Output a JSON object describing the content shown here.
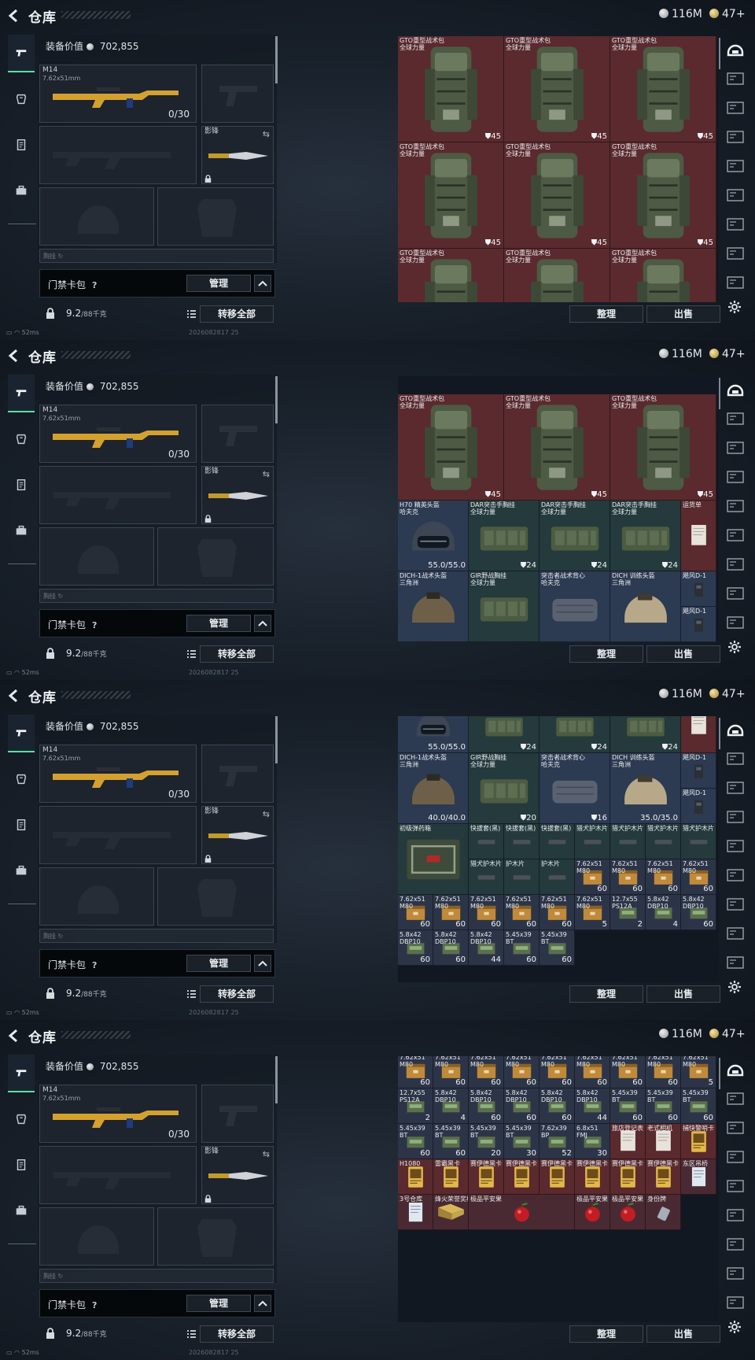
{
  "header": {
    "title": "仓库",
    "currency_silver": "116M",
    "currency_gold": "47+"
  },
  "loadout": {
    "value_label": "装备价值",
    "value": "702,855",
    "primary_weapon": {
      "name": "M14",
      "caliber": "7.62x51mm",
      "ammo": "0/30"
    },
    "melee": {
      "name": "影锋"
    },
    "strip_label": "胸挂 ↻"
  },
  "bag": {
    "name": "门禁卡包",
    "help": "?",
    "manage_label": "管理",
    "weight": "9.2",
    "weight_max": "/88千克",
    "transfer_all_label": "转移全部"
  },
  "storage": {
    "sort_label": "整理",
    "sell_label": "出售"
  },
  "status": {
    "ping": "52ms",
    "date": "2026082817 25"
  },
  "colors": {
    "accent_green": "#5be0a0",
    "tile_red": "#5a2a2e",
    "tile_blue": "#2c3a52",
    "tile_teal": "#243a3c"
  },
  "frames": [
    {
      "items": [
        {
          "n": "GTO重型战术包\n全球力量",
          "q": "⛊45",
          "t": "backpack"
        },
        {
          "n": "GTO重型战术包\n全球力量",
          "q": "⛊45",
          "t": "backpack"
        },
        {
          "n": "GTO重型战术包\n全球力量",
          "q": "⛊45",
          "t": "backpack"
        },
        {
          "n": "GTO重型战术包\n全球力量",
          "q": "⛊45",
          "t": "backpack"
        },
        {
          "n": "GTO重型战术包\n全球力量",
          "q": "⛊45",
          "t": "backpack"
        },
        {
          "n": "GTO重型战术包\n全球力量",
          "q": "⛊45",
          "t": "backpack"
        },
        {
          "n": "GTO重型战术包\n全球力量",
          "q": "",
          "t": "backpack"
        },
        {
          "n": "GTO重型战术包\n全球力量",
          "q": "",
          "t": "backpack"
        },
        {
          "n": "GTO重型战术包\n全球力量",
          "q": "",
          "t": "backpack"
        }
      ]
    },
    {
      "items": [
        {
          "n": "",
          "q": "⛊45",
          "t": "backpack"
        },
        {
          "n": "",
          "q": "⛊45",
          "t": "backpack"
        },
        {
          "n": "",
          "q": "⛊45",
          "t": "backpack"
        },
        {
          "n": "GTO重型战术包\n全球力量",
          "q": "⛊45",
          "t": "backpack"
        },
        {
          "n": "GTO重型战术包\n全球力量",
          "q": "⛊45",
          "t": "backpack"
        },
        {
          "n": "GTO重型战术包\n全球力量",
          "q": "⛊45",
          "t": "backpack"
        },
        {
          "n": "H70 精英头盔\n哈夫克",
          "q": "55.0/55.0",
          "t": "helmet"
        },
        {
          "n": "DAR突击手胸挂\n全球力量",
          "q": "⛊24",
          "t": "rig"
        },
        {
          "n": "DAR突击手胸挂\n全球力量",
          "q": "⛊24",
          "t": "rig"
        },
        {
          "n": "DAR突击手胸挂\n全球力量",
          "q": "⛊24",
          "t": "rig"
        },
        {
          "n": "运货单",
          "q": "",
          "t": "paper"
        },
        {
          "n": "DICH-1战术头盔\n三角洲",
          "q": "",
          "t": "helmet2"
        },
        {
          "n": "GIR野战胸挂\n全球力量",
          "q": "",
          "t": "rig"
        },
        {
          "n": "突击者战术背心\n哈夫克",
          "q": "",
          "t": "vest"
        },
        {
          "n": "DICH 训练头盔\n三角洲",
          "q": "",
          "t": "helmet3"
        },
        {
          "n": "飓风D-1",
          "q": "",
          "t": "device"
        },
        {
          "n": "飓风D-1",
          "q": "",
          "t": "device"
        }
      ]
    },
    {
      "items": [
        {
          "n": "",
          "q": "55.0/55.0",
          "t": "helmet"
        },
        {
          "n": "",
          "q": "⛊24",
          "t": "rig"
        },
        {
          "n": "",
          "q": "⛊24",
          "t": "rig"
        },
        {
          "n": "",
          "q": "⛊24",
          "t": "rig"
        },
        {
          "n": "",
          "q": "",
          "t": "paper"
        },
        {
          "n": "DICH-1战术头盔\n三角洲",
          "q": "40.0/40.0",
          "t": "helmet2"
        },
        {
          "n": "GIR野战胸挂\n全球力量",
          "q": "⛊20",
          "t": "rig"
        },
        {
          "n": "突击者战术背心\n哈夫克",
          "q": "⛊16",
          "t": "vest"
        },
        {
          "n": "DICH 训练头盔\n三角洲",
          "q": "35.0/35.0",
          "t": "helmet3"
        },
        {
          "n": "飓风D-1",
          "q": "",
          "t": "device"
        },
        {
          "n": "飓风D-1",
          "q": "",
          "t": "device"
        },
        {
          "n": "初级弹药箱",
          "q": "",
          "t": "ammobox"
        },
        {
          "n": "快拔套(黑)",
          "q": "",
          "t": "small"
        },
        {
          "n": "快拔套(黑)",
          "q": "",
          "t": "small"
        },
        {
          "n": "快拔套(黑)",
          "q": "",
          "t": "small"
        },
        {
          "n": "猎犬护木片",
          "q": "",
          "t": "small"
        },
        {
          "n": "猎犬护木片",
          "q": "",
          "t": "small"
        },
        {
          "n": "猎犬护木片",
          "q": "",
          "t": "small"
        },
        {
          "n": "猎犬护木片",
          "q": "",
          "t": "small"
        },
        {
          "n": "猎犬护木片",
          "q": "",
          "t": "small"
        },
        {
          "n": "护木片",
          "q": "",
          "t": "small"
        },
        {
          "n": "护木片",
          "q": "",
          "t": "small"
        },
        {
          "n": "7.62x51\nM80",
          "q": "60",
          "t": "ammo"
        },
        {
          "n": "7.62x51\nM80",
          "q": "60",
          "t": "ammo"
        },
        {
          "n": "7.62x51\nM80",
          "q": "60",
          "t": "ammo"
        },
        {
          "n": "7.62x51\nM80",
          "q": "60",
          "t": "ammo"
        },
        {
          "n": "7.62x51\nM80",
          "q": "60",
          "t": "ammo"
        },
        {
          "n": "7.62x51\nM80",
          "q": "60",
          "t": "ammo"
        },
        {
          "n": "7.62x51\nM80",
          "q": "60",
          "t": "ammo"
        },
        {
          "n": "7.62x51\nM80",
          "q": "60",
          "t": "ammo"
        },
        {
          "n": "7.62x51\nM80",
          "q": "60",
          "t": "ammo"
        },
        {
          "n": "7.62x51\nM80",
          "q": "5",
          "t": "ammo"
        },
        {
          "n": "12.7x55\nPS12A",
          "q": "2",
          "t": "ammo2"
        },
        {
          "n": "5.8x42\nDBP10",
          "q": "4",
          "t": "ammo2"
        },
        {
          "n": "5.8x42\nDBP10",
          "q": "60",
          "t": "ammo2"
        },
        {
          "n": "5.8x42\nDBP10",
          "q": "60",
          "t": "ammo2"
        },
        {
          "n": "5.8x42\nDBP10",
          "q": "60",
          "t": "ammo2"
        },
        {
          "n": "5.8x42\nDBP10",
          "q": "44",
          "t": "ammo2"
        },
        {
          "n": "5.45x39\nBT",
          "q": "60",
          "t": "ammo2"
        },
        {
          "n": "5.45x39\nBT",
          "q": "60",
          "t": "ammo2"
        }
      ]
    },
    {
      "items": [
        {
          "n": "7.62x51\nM80",
          "q": "60",
          "t": "ammo"
        },
        {
          "n": "7.62x51\nM80",
          "q": "60",
          "t": "ammo"
        },
        {
          "n": "7.62x51\nM80",
          "q": "60",
          "t": "ammo"
        },
        {
          "n": "7.62x51\nM80",
          "q": "60",
          "t": "ammo"
        },
        {
          "n": "7.62x51\nM80",
          "q": "60",
          "t": "ammo"
        },
        {
          "n": "7.62x51\nM80",
          "q": "60",
          "t": "ammo"
        },
        {
          "n": "7.62x51\nM80",
          "q": "60",
          "t": "ammo"
        },
        {
          "n": "7.62x51\nM80",
          "q": "60",
          "t": "ammo"
        },
        {
          "n": "7.62x51\nM80",
          "q": "5",
          "t": "ammo"
        },
        {
          "n": "12.7x55\nPS12A",
          "q": "2",
          "t": "ammo2"
        },
        {
          "n": "5.8x42\nDBP10",
          "q": "4",
          "t": "ammo2"
        },
        {
          "n": "5.8x42\nDBP10",
          "q": "60",
          "t": "ammo2"
        },
        {
          "n": "5.8x42\nDBP10",
          "q": "60",
          "t": "ammo2"
        },
        {
          "n": "5.8x42\nDBP10",
          "q": "60",
          "t": "ammo2"
        },
        {
          "n": "5.8x42\nDBP10",
          "q": "44",
          "t": "ammo2"
        },
        {
          "n": "5.45x39\nBT",
          "q": "60",
          "t": "ammo2"
        },
        {
          "n": "5.45x39\nBT",
          "q": "60",
          "t": "ammo2"
        },
        {
          "n": "5.45x39\nBT",
          "q": "60",
          "t": "ammo2"
        },
        {
          "n": "5.45x39\nBT",
          "q": "60",
          "t": "ammo2"
        },
        {
          "n": "5.45x39\nBT",
          "q": "60",
          "t": "ammo2"
        },
        {
          "n": "5.45x39\nBT",
          "q": "20",
          "t": "ammo2"
        },
        {
          "n": "5.45x39\nBT",
          "q": "30",
          "t": "ammo2"
        },
        {
          "n": "7.62x39\nBP",
          "q": "52",
          "t": "ammo2"
        },
        {
          "n": "6.8x51\nFMJ",
          "q": "30",
          "t": "ammo2"
        },
        {
          "n": "旅店登记表",
          "q": "",
          "t": "paper"
        },
        {
          "n": "老式相机",
          "q": "",
          "t": "paper"
        },
        {
          "n": "捕快警哨卡",
          "q": "",
          "t": "card"
        },
        {
          "n": "H1080",
          "q": "",
          "t": "card"
        },
        {
          "n": "雷霸黑卡",
          "q": "",
          "t": "card"
        },
        {
          "n": "赛伊德黑卡",
          "q": "",
          "t": "card"
        },
        {
          "n": "赛伊德黑卡",
          "q": "",
          "t": "card"
        },
        {
          "n": "赛伊德黑卡",
          "q": "",
          "t": "card"
        },
        {
          "n": "赛伊德黑卡",
          "q": "",
          "t": "card"
        },
        {
          "n": "赛伊德黑卡",
          "q": "",
          "t": "card"
        },
        {
          "n": "赛伊德黑卡",
          "q": "",
          "t": "card"
        },
        {
          "n": "东区吊桥",
          "q": "",
          "t": "doc"
        },
        {
          "n": "3号仓库",
          "q": "",
          "t": "doc"
        },
        {
          "n": "烽火荣誉奖杯",
          "q": "",
          "t": "trophy"
        },
        {
          "n": "极品平安果",
          "q": "",
          "t": "apple"
        },
        {
          "n": "极品平安果",
          "q": "",
          "t": "apple"
        },
        {
          "n": "极品平安果",
          "q": "",
          "t": "apple"
        },
        {
          "n": "身份牌",
          "q": "",
          "t": "tag"
        }
      ]
    }
  ]
}
